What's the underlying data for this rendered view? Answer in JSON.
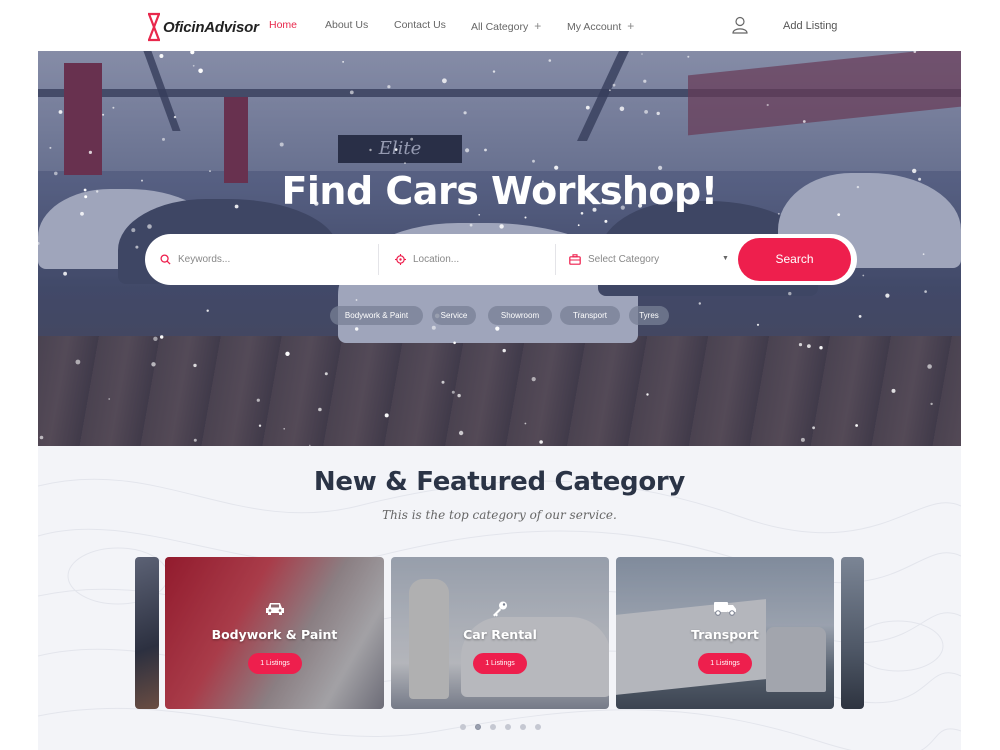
{
  "brand": {
    "name": "OficinAdvisor",
    "accent": "#e8284c"
  },
  "nav": {
    "items": [
      {
        "label": "Home",
        "active": true
      },
      {
        "label": "About Us"
      },
      {
        "label": "Contact Us"
      },
      {
        "label": "All Category",
        "has_submenu": true
      },
      {
        "label": "My Account",
        "has_submenu": true
      }
    ],
    "submenu_glyph": "+",
    "user_icon": "user-icon",
    "add_listing": "Add Listing"
  },
  "hero": {
    "title": "Find Cars Workshop!",
    "search": {
      "keywords_placeholder": "Keywords...",
      "location_placeholder": "Location...",
      "category_selected": "Select Category",
      "button": "Search",
      "button_color": "#ee1f4d"
    },
    "tags": [
      "Bodywork & Paint",
      "Service",
      "Showroom",
      "Transport",
      "Tyres"
    ],
    "sign_text": "Elite"
  },
  "featured": {
    "title": "New & Featured Category",
    "subtitle": "This is the top category of our service.",
    "cards": [
      {
        "name": "Bodywork & Paint",
        "listings": "1 Listings",
        "icon": "car-icon"
      },
      {
        "name": "Car Rental",
        "listings": "1 Listings",
        "icon": "key-icon"
      },
      {
        "name": "Transport",
        "listings": "1 Listings",
        "icon": "truck-icon"
      }
    ],
    "pager": {
      "pages": 6,
      "active": 2
    }
  }
}
